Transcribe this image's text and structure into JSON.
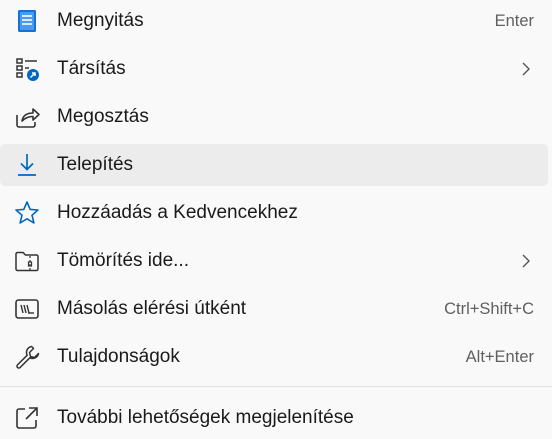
{
  "menu": {
    "items": [
      {
        "label": "Megnyitás",
        "shortcut": "Enter",
        "icon": "document-icon"
      },
      {
        "label": "Társítás",
        "shortcut": "",
        "icon": "associate-icon",
        "submenu": true
      },
      {
        "label": "Megosztás",
        "shortcut": "",
        "icon": "share-icon"
      },
      {
        "label": "Telepítés",
        "shortcut": "",
        "icon": "download-icon",
        "hovered": true
      },
      {
        "label": "Hozzáadás a Kedvencekhez",
        "shortcut": "",
        "icon": "star-icon"
      },
      {
        "label": "Tömörítés ide...",
        "shortcut": "",
        "icon": "zip-folder-icon",
        "submenu": true
      },
      {
        "label": "Másolás elérési útként",
        "shortcut": "Ctrl+Shift+C",
        "icon": "copy-path-icon"
      },
      {
        "label": "Tulajdonságok",
        "shortcut": "Alt+Enter",
        "icon": "wrench-icon"
      },
      {
        "label": "További lehetőségek megjelenítése",
        "shortcut": "",
        "icon": "open-external-icon"
      }
    ]
  },
  "colors": {
    "background": "#f9f9f9",
    "hover": "#ececec",
    "accent": "#0067c0",
    "text": "#1a1a1a",
    "shortcut_text": "#606060"
  }
}
